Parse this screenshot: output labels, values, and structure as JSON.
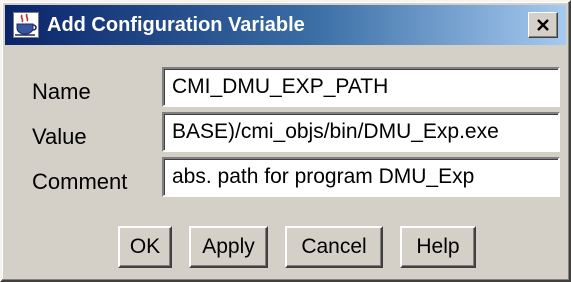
{
  "window": {
    "title": "Add Configuration Variable",
    "app_icon": "java-coffee-cup-icon",
    "close_icon": "close-x-icon"
  },
  "form": {
    "name": {
      "label": "Name",
      "value": "CMI_DMU_EXP_PATH"
    },
    "value": {
      "label": "Value",
      "value": "BASE)/cmi_objs/bin/DMU_Exp.exe"
    },
    "comment": {
      "label": "Comment",
      "value": "abs. path for program DMU_Exp"
    }
  },
  "buttons": {
    "ok": "OK",
    "apply": "Apply",
    "cancel": "Cancel",
    "help": "Help"
  },
  "colors": {
    "title_gradient_start": "#0a246a",
    "title_gradient_end": "#a6caf0",
    "dialog_background": "#d4d0c8",
    "field_background": "#ffffff"
  }
}
